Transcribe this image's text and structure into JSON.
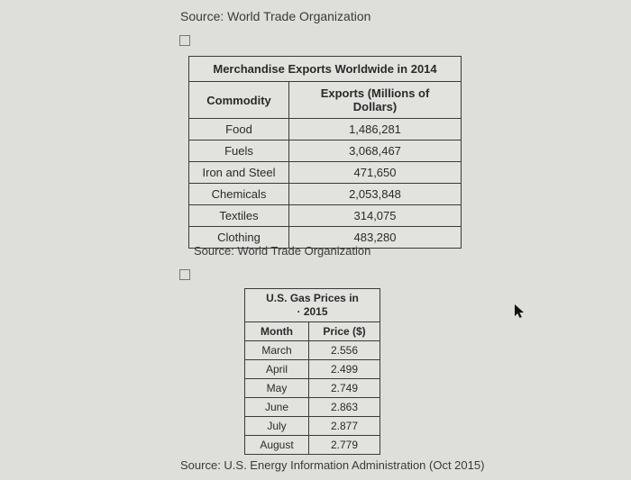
{
  "source_top": "Source: World Trade Organization",
  "source_mid": "Source: World Trade Organization",
  "source_bot": "Source: U.S. Energy Information Administration (Oct 2015)",
  "table1": {
    "title": "Merchandise Exports Worldwide in 2014",
    "col1": "Commodity",
    "col2": "Exports (Millions of Dollars)",
    "rows": [
      {
        "commodity": "Food",
        "value": "1,486,281"
      },
      {
        "commodity": "Fuels",
        "value": "3,068,467"
      },
      {
        "commodity": "Iron and Steel",
        "value": "471,650"
      },
      {
        "commodity": "Chemicals",
        "value": "2,053,848"
      },
      {
        "commodity": "Textiles",
        "value": "314,075"
      },
      {
        "commodity": "Clothing",
        "value": "483,280"
      }
    ]
  },
  "table2": {
    "title_l1": "U.S. Gas Prices in",
    "title_l2": "· 2015",
    "col1": "Month",
    "col2": "Price ($)",
    "rows": [
      {
        "month": "March",
        "price": "2.556"
      },
      {
        "month": "April",
        "price": "2.499"
      },
      {
        "month": "May",
        "price": "2.749"
      },
      {
        "month": "June",
        "price": "2.863"
      },
      {
        "month": "July",
        "price": "2.877"
      },
      {
        "month": "August",
        "price": "2.779"
      }
    ]
  },
  "chart_data": [
    {
      "type": "table",
      "title": "Merchandise Exports Worldwide in 2014",
      "xlabel": "Commodity",
      "ylabel": "Exports (Millions of Dollars)",
      "categories": [
        "Food",
        "Fuels",
        "Iron and Steel",
        "Chemicals",
        "Textiles",
        "Clothing"
      ],
      "values": [
        1486281,
        3068467,
        471650,
        2053848,
        314075,
        483280
      ]
    },
    {
      "type": "table",
      "title": "U.S. Gas Prices in 2015",
      "xlabel": "Month",
      "ylabel": "Price ($)",
      "categories": [
        "March",
        "April",
        "May",
        "June",
        "July",
        "August"
      ],
      "values": [
        2.556,
        2.499,
        2.749,
        2.863,
        2.877,
        2.779
      ]
    }
  ]
}
